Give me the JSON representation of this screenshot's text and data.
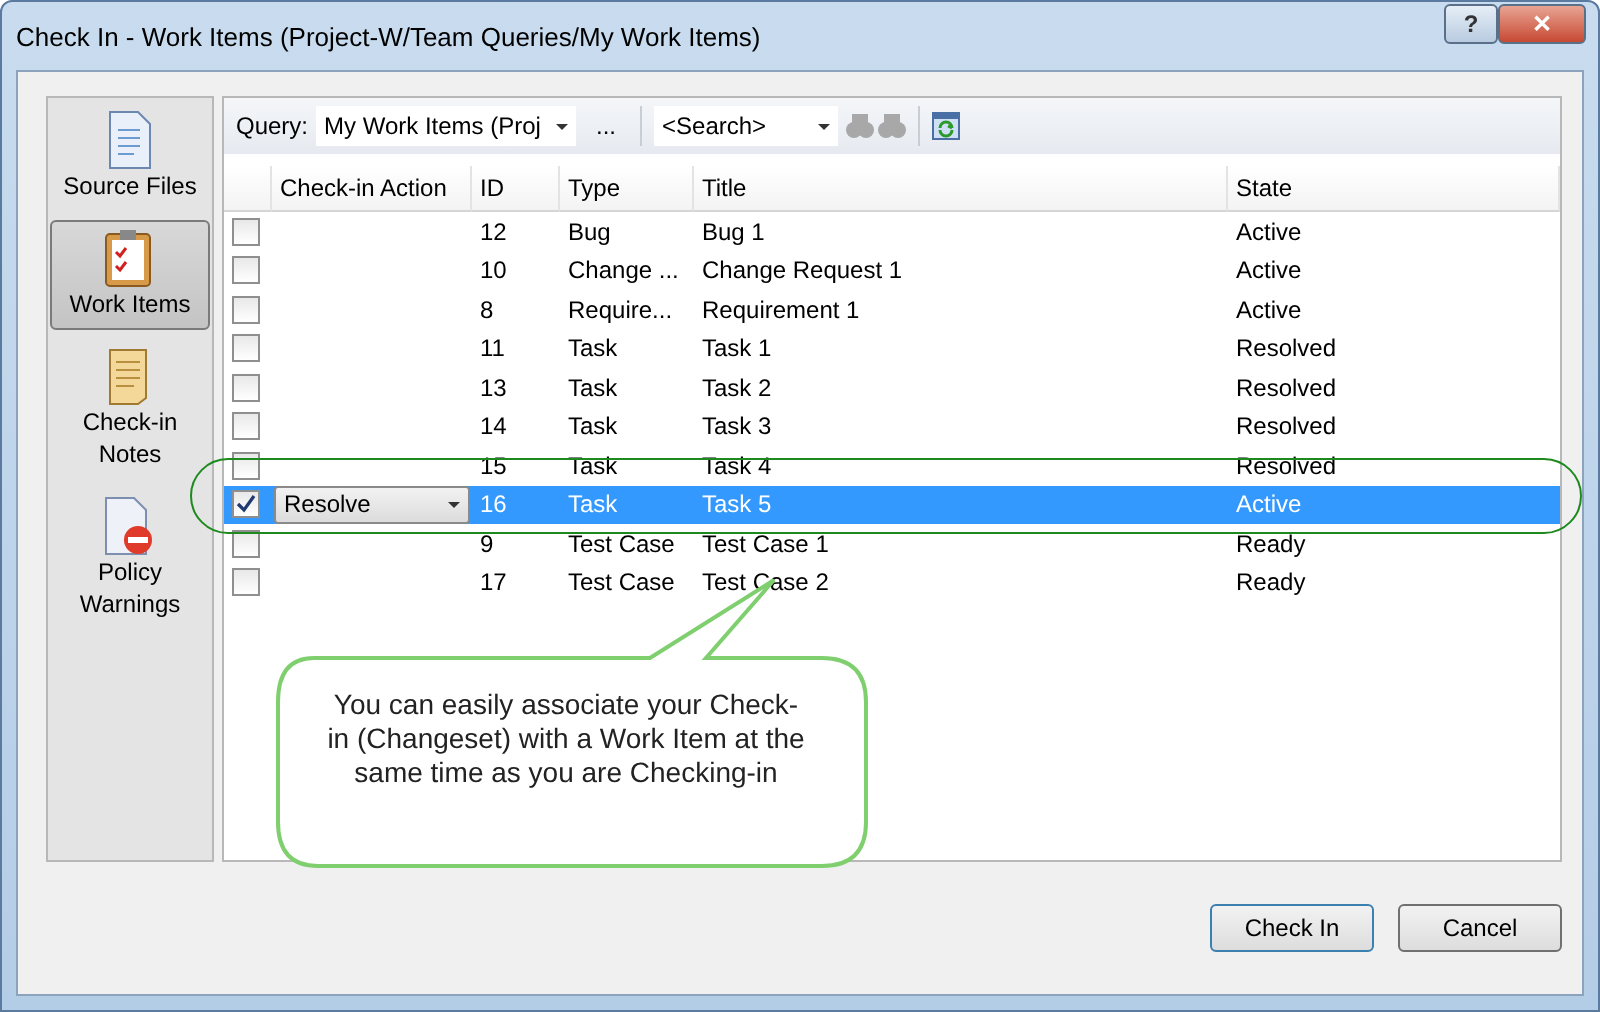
{
  "window": {
    "title": "Check In - Work Items (Project-W/Team Queries/My Work Items)",
    "help": "?",
    "close": "✕"
  },
  "sidebar": {
    "items": [
      {
        "label": "Source Files",
        "selected": false
      },
      {
        "label": "Work Items",
        "selected": true
      },
      {
        "label": "Check-in Notes",
        "selected": false
      },
      {
        "label": "Policy Warnings",
        "selected": false
      }
    ]
  },
  "toolbar": {
    "query_label": "Query:",
    "query_value": "My Work Items (Proj",
    "browse": "...",
    "search_placeholder": "<Search>"
  },
  "table": {
    "columns": [
      "Check-in Action",
      "ID",
      "Type",
      "Title",
      "State"
    ],
    "rows": [
      {
        "checked": false,
        "selected": false,
        "id": "12",
        "type": "Bug",
        "title": "Bug 1",
        "state": "Active"
      },
      {
        "checked": false,
        "selected": false,
        "id": "10",
        "type": "Change ...",
        "title": "Change Request 1",
        "state": "Active"
      },
      {
        "checked": false,
        "selected": false,
        "id": "8",
        "type": "Require...",
        "title": "Requirement 1",
        "state": "Active"
      },
      {
        "checked": false,
        "selected": false,
        "id": "11",
        "type": "Task",
        "title": "Task 1",
        "state": "Resolved"
      },
      {
        "checked": false,
        "selected": false,
        "id": "13",
        "type": "Task",
        "title": "Task 2",
        "state": "Resolved"
      },
      {
        "checked": false,
        "selected": false,
        "id": "14",
        "type": "Task",
        "title": "Task 3",
        "state": "Resolved"
      },
      {
        "checked": false,
        "selected": false,
        "id": "15",
        "type": "Task",
        "title": "Task 4",
        "state": "Resolved"
      },
      {
        "checked": true,
        "selected": true,
        "action": "Resolve",
        "id": "16",
        "type": "Task",
        "title": "Task 5",
        "state": "Active"
      },
      {
        "checked": false,
        "selected": false,
        "id": "9",
        "type": "Test Case",
        "title": "Test Case 1",
        "state": "Ready"
      },
      {
        "checked": false,
        "selected": false,
        "id": "17",
        "type": "Test Case",
        "title": "Test Case 2",
        "state": "Ready"
      }
    ]
  },
  "callout": "You can easily associate your Check-in (Changeset) with a Work Item at the same time as you are Checking-in",
  "buttons": [
    "Check In",
    "Cancel"
  ]
}
